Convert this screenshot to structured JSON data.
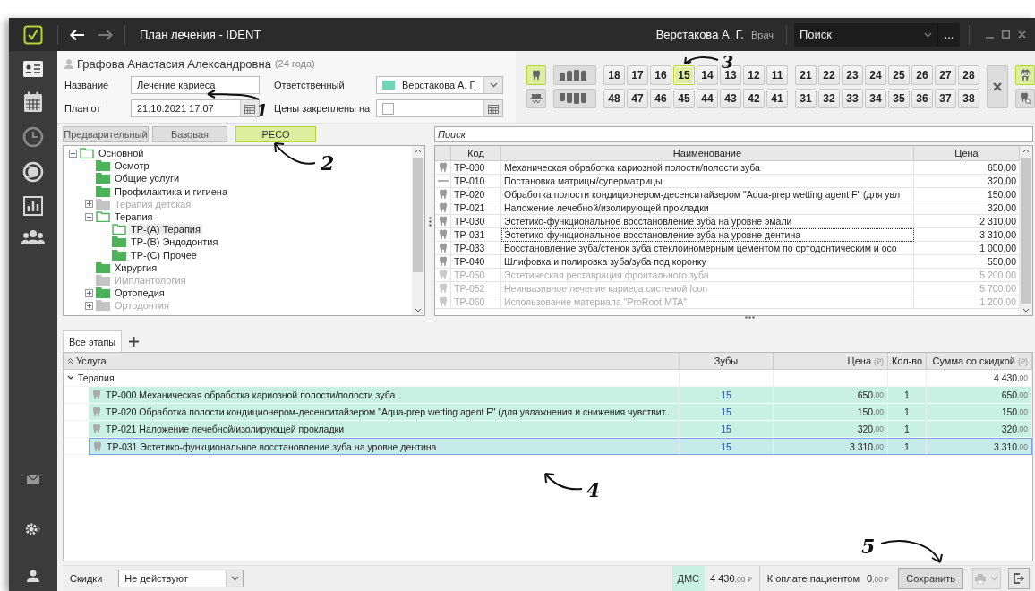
{
  "window": {
    "title": "План лечения  -  IDENT",
    "user": "Верстакова А. Г.",
    "role": "Врач",
    "search": {
      "value": "Поиск"
    },
    "more": "..."
  },
  "patient": {
    "name": "Графова Анастасия Александровна",
    "age": "(24 года)"
  },
  "form": {
    "name_label": "Название",
    "name_value": "Лечение кариеса",
    "date_label": "План от",
    "date_value": "21.10.2021 17:07",
    "responsible_label": "Ответственный",
    "responsible_value": "Верстакова А. Г.",
    "prices_label": "Цены закреплены на",
    "prices_checked": false
  },
  "tooth_tools": [
    {
      "kind": "tooth",
      "selected": true
    },
    {
      "kind": "crown",
      "selected": false
    }
  ],
  "jaw_tools": [
    {
      "kind": "upper-jaw",
      "selected": false
    },
    {
      "kind": "lower-jaw",
      "selected": false
    }
  ],
  "teeth": {
    "upper_right": [
      {
        "label": "18",
        "selected": false
      },
      {
        "label": "17",
        "selected": false
      },
      {
        "label": "16",
        "selected": false
      },
      {
        "label": "15",
        "selected": true
      },
      {
        "label": "14",
        "selected": false
      },
      {
        "label": "13",
        "selected": false
      },
      {
        "label": "12",
        "selected": false
      },
      {
        "label": "11",
        "selected": false
      }
    ],
    "upper_left": [
      {
        "label": "21",
        "selected": false
      },
      {
        "label": "22",
        "selected": false
      },
      {
        "label": "23",
        "selected": false
      },
      {
        "label": "24",
        "selected": false
      },
      {
        "label": "25",
        "selected": false
      },
      {
        "label": "26",
        "selected": false
      },
      {
        "label": "27",
        "selected": false
      },
      {
        "label": "28",
        "selected": false
      }
    ],
    "lower_right": [
      {
        "label": "48",
        "selected": false
      },
      {
        "label": "47",
        "selected": false
      },
      {
        "label": "46",
        "selected": false
      },
      {
        "label": "45",
        "selected": false
      },
      {
        "label": "44",
        "selected": false
      },
      {
        "label": "43",
        "selected": false
      },
      {
        "label": "42",
        "selected": false
      },
      {
        "label": "41",
        "selected": false
      }
    ],
    "lower_left": [
      {
        "label": "31",
        "selected": false
      },
      {
        "label": "32",
        "selected": false
      },
      {
        "label": "33",
        "selected": false
      },
      {
        "label": "34",
        "selected": false
      },
      {
        "label": "35",
        "selected": false
      },
      {
        "label": "36",
        "selected": false
      },
      {
        "label": "37",
        "selected": false
      },
      {
        "label": "38",
        "selected": false
      }
    ]
  },
  "side_tools": [
    {
      "kind": "no-tooth",
      "selected": true
    },
    {
      "kind": "tooth-search",
      "selected": false
    }
  ],
  "price_tabs": [
    {
      "label": "Предварительный",
      "selected": false
    },
    {
      "label": "Базовая",
      "selected": false
    },
    {
      "label": "РЕСО",
      "selected": true
    }
  ],
  "tree": [
    {
      "label": "Основной",
      "expanded": true,
      "disabled": false,
      "selected": false,
      "children": [
        {
          "label": "Осмотр",
          "disabled": false,
          "selected": false
        },
        {
          "label": "Общие услуги",
          "disabled": false,
          "selected": false
        },
        {
          "label": "Профилактика и гигиена",
          "disabled": false,
          "selected": false
        },
        {
          "label": "Терапия детская",
          "expanded": false,
          "disabled": true,
          "selected": false
        },
        {
          "label": "Терапия",
          "expanded": true,
          "disabled": false,
          "selected": false,
          "children": [
            {
              "label": "ТР-(А) Терапия",
              "disabled": false,
              "selected": true
            },
            {
              "label": "ТР-(В) Эндодонтия",
              "disabled": false,
              "selected": false
            },
            {
              "label": "ТР-(С) Прочее",
              "disabled": false,
              "selected": false
            }
          ]
        },
        {
          "label": "Хирургия",
          "disabled": false,
          "selected": false
        },
        {
          "label": "Имплантология",
          "disabled": true,
          "selected": false
        },
        {
          "label": "Ортопедия",
          "expanded": false,
          "disabled": false,
          "selected": false
        },
        {
          "label": "Ортодонтия",
          "expanded": false,
          "disabled": true,
          "selected": false
        }
      ]
    }
  ],
  "catalog": {
    "search_placeholder": "Поиск",
    "columns": [
      "Код",
      "Наименование",
      "Цена"
    ],
    "rows": [
      {
        "kind": "tooth",
        "code": "ТР-000",
        "name": "Механическая обработка кариозной полости/полости зуба",
        "price": "650,00",
        "disabled": false,
        "selected": false
      },
      {
        "kind": "line",
        "code": "ТР-010",
        "name": "Постановка матрицы/суперматрицы",
        "price": "320,00",
        "disabled": false,
        "selected": false
      },
      {
        "kind": "tooth",
        "code": "ТР-020",
        "name": "Обработка полости кондиционером-десенситайзером \"Aqua-prep wetting agent F\" (для увл",
        "price": "150,00",
        "disabled": false,
        "selected": false
      },
      {
        "kind": "tooth",
        "code": "ТР-021",
        "name": "Наложение лечебной/изолирующей прокладки",
        "price": "320,00",
        "disabled": false,
        "selected": false
      },
      {
        "kind": "tooth",
        "code": "ТР-030",
        "name": "Эстетико-функциональное восстановление зуба на уровне эмали",
        "price": "2 310,00",
        "disabled": false,
        "selected": false
      },
      {
        "kind": "tooth",
        "code": "ТР-031",
        "name": "Эстетико-функциональное восстановление зуба на уровне дентина",
        "price": "3 310,00",
        "disabled": false,
        "selected": true
      },
      {
        "kind": "tooth",
        "code": "ТР-033",
        "name": "Восстановление зуба/стенок зуба стеклоиномерным цементом по ортодонтическим и осо",
        "price": "1 000,00",
        "disabled": false,
        "selected": false
      },
      {
        "kind": "tooth",
        "code": "ТР-040",
        "name": "Шлифовка и полировка зуба/зуба под коронку",
        "price": "550,00",
        "disabled": false,
        "selected": false
      },
      {
        "kind": "tooth",
        "code": "ТР-050",
        "name": "Эстетическая реставрация фронтального зуба",
        "price": "5 200,00",
        "disabled": true,
        "selected": false
      },
      {
        "kind": "tooth",
        "code": "ТР-052",
        "name": "Неинвазивное лечение кариеса системой Icon",
        "price": "5 700,00",
        "disabled": true,
        "selected": false
      },
      {
        "kind": "tooth",
        "code": "ТР-060",
        "name": "Использование материала \"ProRoot MTA\"",
        "price": "1 200,00",
        "disabled": true,
        "selected": false
      }
    ]
  },
  "stage_tabs": [
    {
      "label": "Все этапы",
      "selected": true
    }
  ],
  "plan": {
    "columns": [
      {
        "label": "Услуга"
      },
      {
        "label": "Зубы"
      },
      {
        "label": "Цена",
        "unit": "(₽)"
      },
      {
        "label": "Кол-во"
      },
      {
        "label": "Сумма со скидкой",
        "unit": "(₽)"
      }
    ],
    "groups": [
      {
        "label": "Терапия",
        "expanded": true,
        "total": "4 430",
        "total_cents": ",00",
        "rows": [
          {
            "service": "ТР-000 Механическая обработка кариозной полости/полости зуба",
            "teeth": "15",
            "price": "650",
            "price_cents": ",00",
            "qty": "1",
            "sum": "650",
            "sum_cents": ",00",
            "selected": false
          },
          {
            "service": "ТР-020 Обработка полости кондиционером-десенситайзером \"Aqua-prep wetting agent F\" (для увлажнения и снижения чувствит...",
            "teeth": "15",
            "price": "150",
            "price_cents": ",00",
            "qty": "1",
            "sum": "150",
            "sum_cents": ",00",
            "selected": false
          },
          {
            "service": "ТР-021 Наложение лечебной/изолирующей прокладки",
            "teeth": "15",
            "price": "320",
            "price_cents": ",00",
            "qty": "1",
            "sum": "320",
            "sum_cents": ",00",
            "selected": false
          },
          {
            "service": "ТР-031 Эстетико-функциональное восстановление зуба на уровне дентина",
            "teeth": "15",
            "price": "3 310",
            "price_cents": ",00",
            "qty": "1",
            "sum": "3 310",
            "sum_cents": ",00",
            "selected": true
          }
        ]
      }
    ]
  },
  "footer": {
    "discount_label": "Скидки",
    "discount_value": "Не действуют",
    "dms_label": "ДМС",
    "dms_amount": "4 430",
    "dms_cents": ",00",
    "dms_currency": "₽",
    "to_pay_label": "К оплате пациентом",
    "to_pay_amount": "0",
    "to_pay_cents": ",00",
    "to_pay_currency": "₽",
    "save": "Сохранить",
    "print_disabled": true
  },
  "annotations": [
    {
      "label": "1"
    },
    {
      "label": "2"
    },
    {
      "label": "3"
    },
    {
      "label": "4"
    },
    {
      "label": "5"
    }
  ]
}
